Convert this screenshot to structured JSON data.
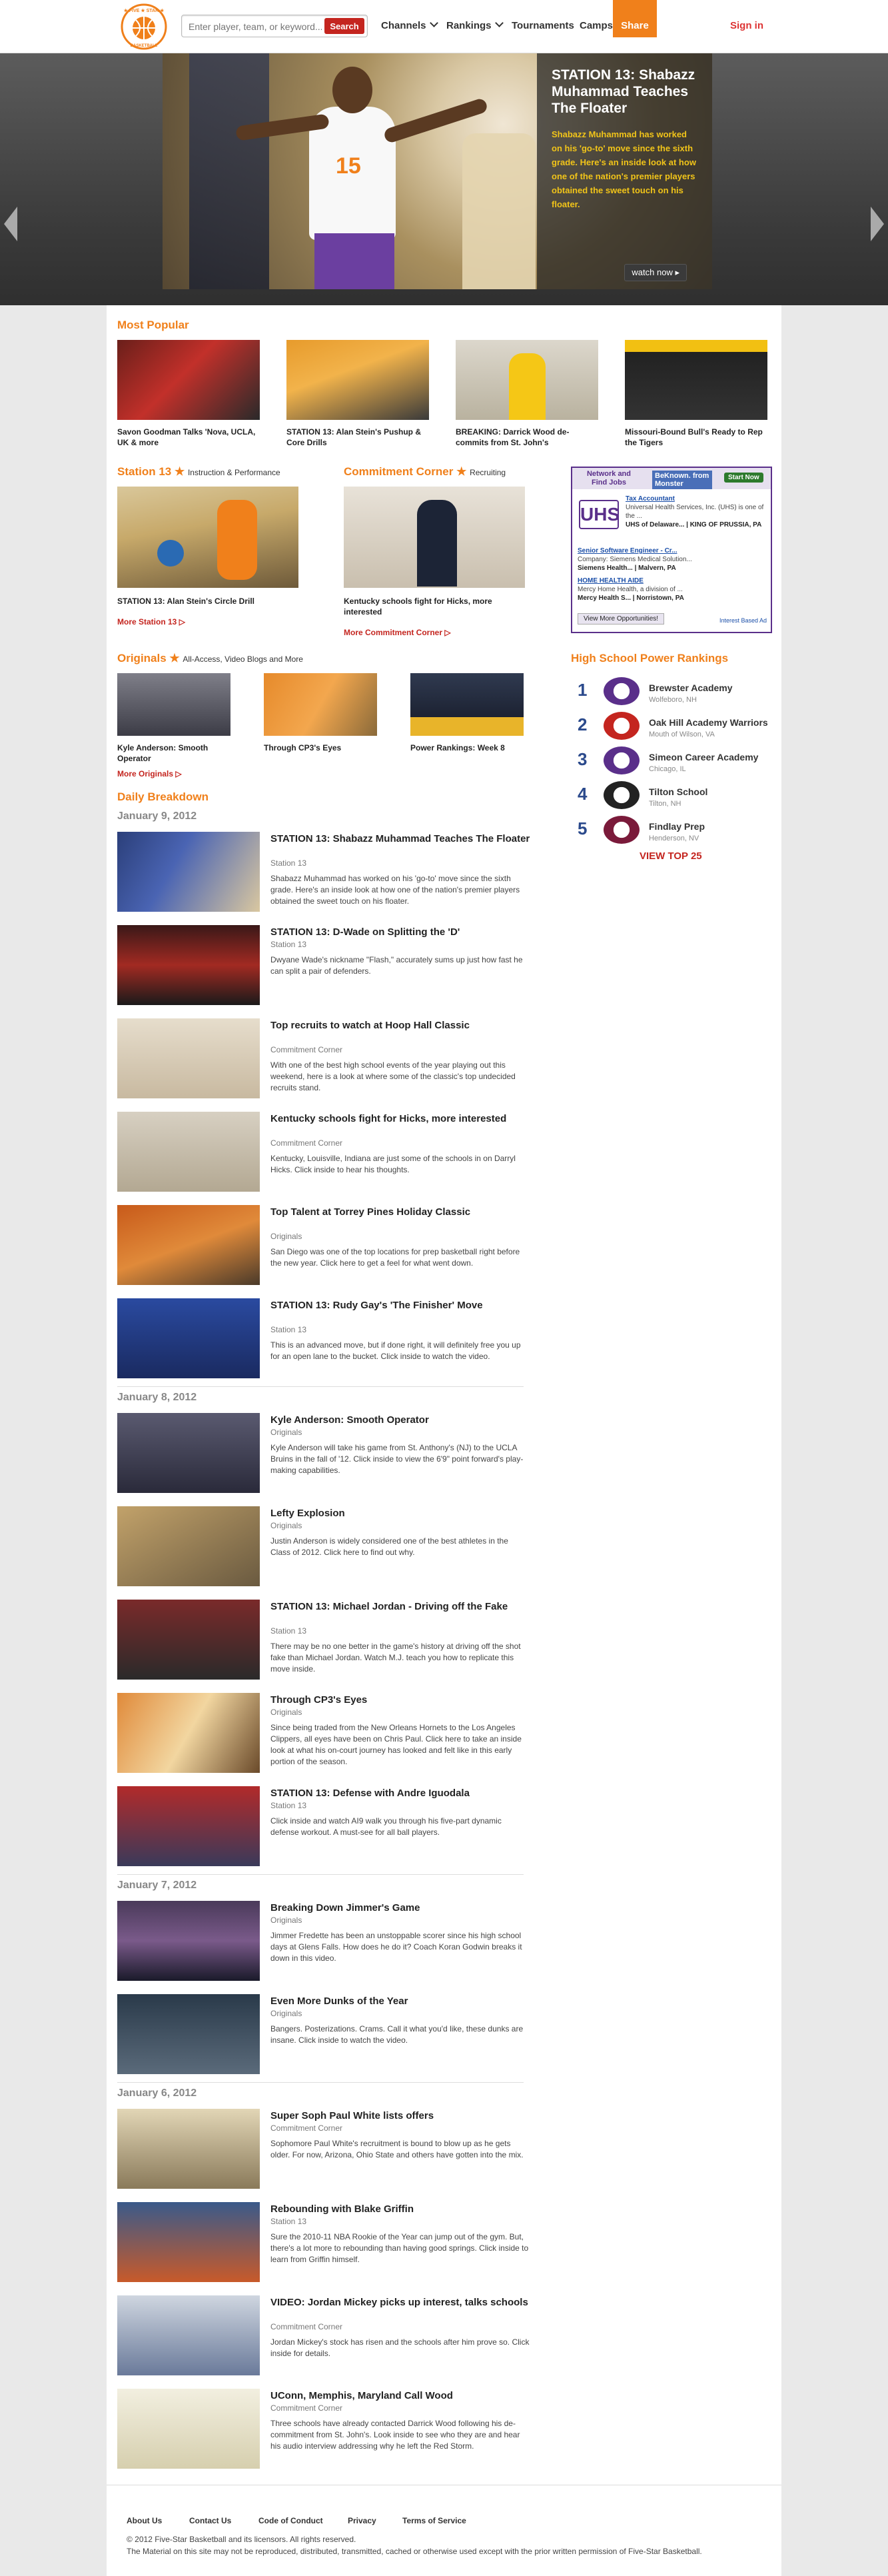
{
  "header": {
    "search_placeholder": "Enter player, team, or keyword...",
    "search_button": "Search",
    "nav": [
      "Channels",
      "Rankings",
      "Tournaments",
      "Camps",
      "Share"
    ],
    "signin": "Sign in",
    "logo_text": "FIVE STAR BASKETBALL"
  },
  "hero": {
    "title": "STATION 13: Shabazz Muhammad Teaches The Floater",
    "text": "Shabazz Muhammad has worked on his 'go-to' move since the sixth grade. Here's an inside look at how one of the nation's premier players obtained the sweet touch on his floater.",
    "watch": "watch now",
    "slides": 10,
    "active_slide": 1
  },
  "most_popular": {
    "title": "Most Popular",
    "items": [
      "Savon Goodman Talks 'Nova, UCLA, UK & more",
      "STATION 13: Alan Stein's Pushup & Core Drills",
      "BREAKING: Darrick Wood de-commits from St. John's",
      "Missouri-Bound Bull's Ready to Rep the Tigers"
    ]
  },
  "station13": {
    "title": "Station 13",
    "sub": "Instruction & Performance",
    "caption": "STATION 13: Alan Stein's Circle Drill",
    "more": "More Station 13"
  },
  "commitment": {
    "title": "Commitment Corner",
    "sub": "Recruiting",
    "caption": "Kentucky schools fight for Hicks, more interested",
    "more": "More Commitment Corner"
  },
  "originals": {
    "title": "Originals",
    "sub": "All-Access, Video Blogs and More",
    "items": [
      "Kyle Anderson: Smooth Operator",
      "Through CP3's Eyes",
      "Power Rankings: Week 8"
    ],
    "more": "More Originals"
  },
  "ad": {
    "header": "Network and Find Jobs",
    "brand": "BeKnown. from Monster",
    "start": "Start Now",
    "logo": "UHS",
    "job1_title": "Tax Accountant",
    "job1_desc": "Universal Health Services, Inc. (UHS) is one of the ...",
    "job1_loc": "UHS of Delaware... | KING OF PRUSSIA, PA",
    "job2_title": "Senior Software Engineer - Cr...",
    "job2_desc": "Company: Siemens Medical Solution...",
    "job2_loc": "Siemens Health... | Malvern, PA",
    "job3_title": "HOME HEALTH AIDE",
    "job3_desc": "Mercy Home Health, a division of ...",
    "job3_loc": "Mercy Health S... | Norristown, PA",
    "view_more": "View More Opportunities!",
    "interest": "Interest Based Ad"
  },
  "power_rankings": {
    "title": "High School Power Rankings",
    "teams": [
      {
        "rank": "1",
        "name": "Brewster Academy",
        "loc": "Wolfeboro, NH"
      },
      {
        "rank": "2",
        "name": "Oak Hill Academy Warriors",
        "loc": "Mouth of Wilson, VA"
      },
      {
        "rank": "3",
        "name": "Simeon Career Academy",
        "loc": "Chicago, IL"
      },
      {
        "rank": "4",
        "name": "Tilton School",
        "loc": "Tilton, NH"
      },
      {
        "rank": "5",
        "name": "Findlay Prep",
        "loc": "Henderson, NV"
      }
    ],
    "view_top": "VIEW TOP 25"
  },
  "daily": {
    "title": "Daily Breakdown",
    "dates": [
      "January 9, 2012",
      "January 8, 2012",
      "January 7, 2012",
      "January 6, 2012"
    ],
    "rows": [
      {
        "t": "STATION 13: Shabazz Muhammad Teaches The Floater",
        "c": "Station 13",
        "d": "Shabazz Muhammad has worked on his 'go-to' move since the sixth grade. Here's an inside look at how one of the nation's premier players obtained the sweet touch on his floater."
      },
      {
        "t": "STATION 13: D-Wade on Splitting the 'D'",
        "c": "Station 13",
        "d": "Dwyane Wade's nickname \"Flash,\" accurately sums up just how fast he can split a pair of defenders."
      },
      {
        "t": "Top recruits to watch at Hoop Hall Classic",
        "c": "Commitment Corner",
        "d": "With one of the best high school events of the year playing out this weekend, here is a look at where some of the classic's top undecided recruits stand."
      },
      {
        "t": "Kentucky schools fight for Hicks, more interested",
        "c": "Commitment Corner",
        "d": "Kentucky, Louisville, Indiana are just some of the schools in on Darryl Hicks. Click inside to hear his thoughts."
      },
      {
        "t": "Top Talent at Torrey Pines Holiday Classic",
        "c": "Originals",
        "d": "San Diego was one of the top locations for prep basketball right before the new year. Click here to get a feel for what went down."
      },
      {
        "t": "STATION 13: Rudy Gay's 'The Finisher' Move",
        "c": "Station 13",
        "d": "This is an advanced move, but if done right, it will definitely free you up for an open lane to the bucket. Click inside to watch the video."
      },
      {
        "t": "Kyle Anderson: Smooth Operator",
        "c": "Originals",
        "d": "Kyle Anderson will take his game from St. Anthony's (NJ) to the UCLA Bruins in the fall of '12. Click inside to view the 6'9\" point forward's play-making capabilities."
      },
      {
        "t": "Lefty Explosion",
        "c": "Originals",
        "d": "Justin Anderson is widely considered one of the best athletes in the Class of 2012. Click here to find out why."
      },
      {
        "t": "STATION 13: Michael Jordan - Driving off the Fake",
        "c": "Station 13",
        "d": "There may be no one better in the game's history at driving off the shot fake than Michael Jordan. Watch M.J. teach you how to replicate this move inside."
      },
      {
        "t": "Through CP3's Eyes",
        "c": "Originals",
        "d": "Since being traded from the New Orleans Hornets to the Los Angeles Clippers, all eyes have been on Chris Paul. Click here to take an inside look at what his on-court journey has looked and felt like in this early portion of the season."
      },
      {
        "t": "STATION 13: Defense with Andre Iguodala",
        "c": "Station 13",
        "d": "Click inside and watch AI9 walk you through his five-part dynamic defense workout. A must-see for all ball players."
      },
      {
        "t": "Breaking Down Jimmer's Game",
        "c": "Originals",
        "d": "Jimmer Fredette has been an unstoppable scorer since his high school days at Glens Falls. How does he do it? Coach Koran Godwin breaks it down in this video."
      },
      {
        "t": "Even More Dunks of the Year",
        "c": "Originals",
        "d": "Bangers. Posterizations. Crams. Call it what you'd like, these dunks are insane. Click inside to watch the video."
      },
      {
        "t": "Super Soph Paul White lists offers",
        "c": "Commitment Corner",
        "d": "Sophomore Paul White's recruitment is bound to blow up as he gets older. For now, Arizona, Ohio State and others have gotten into the mix."
      },
      {
        "t": "Rebounding with Blake Griffin",
        "c": "Station 13",
        "d": "Sure the 2010-11 NBA Rookie of the Year can jump out of the gym. But, there's a lot more to rebounding than having good springs. Click inside to learn from Griffin himself."
      },
      {
        "t": "VIDEO: Jordan Mickey picks up interest, talks schools",
        "c": "Commitment Corner",
        "d": "Jordan Mickey's stock has risen and the schools after him prove so. Click inside for details."
      },
      {
        "t": "UConn, Memphis, Maryland Call Wood",
        "c": "Commitment Corner",
        "d": "Three schools have already contacted Darrick Wood following his de-commitment from St. John's. Look inside to see who they are and hear his audio interview addressing why he left the Red Storm."
      }
    ]
  },
  "footer": {
    "links": [
      "About Us",
      "Contact Us",
      "Code of Conduct",
      "Privacy",
      "Terms of Service"
    ],
    "copyright": "© 2012 Five-Star Basketball and its licensors. All rights reserved.",
    "legal": "The Material on this site may not be reproduced, distributed, transmitted, cached or otherwise used except with the prior written permission of Five-Star Basketball."
  }
}
